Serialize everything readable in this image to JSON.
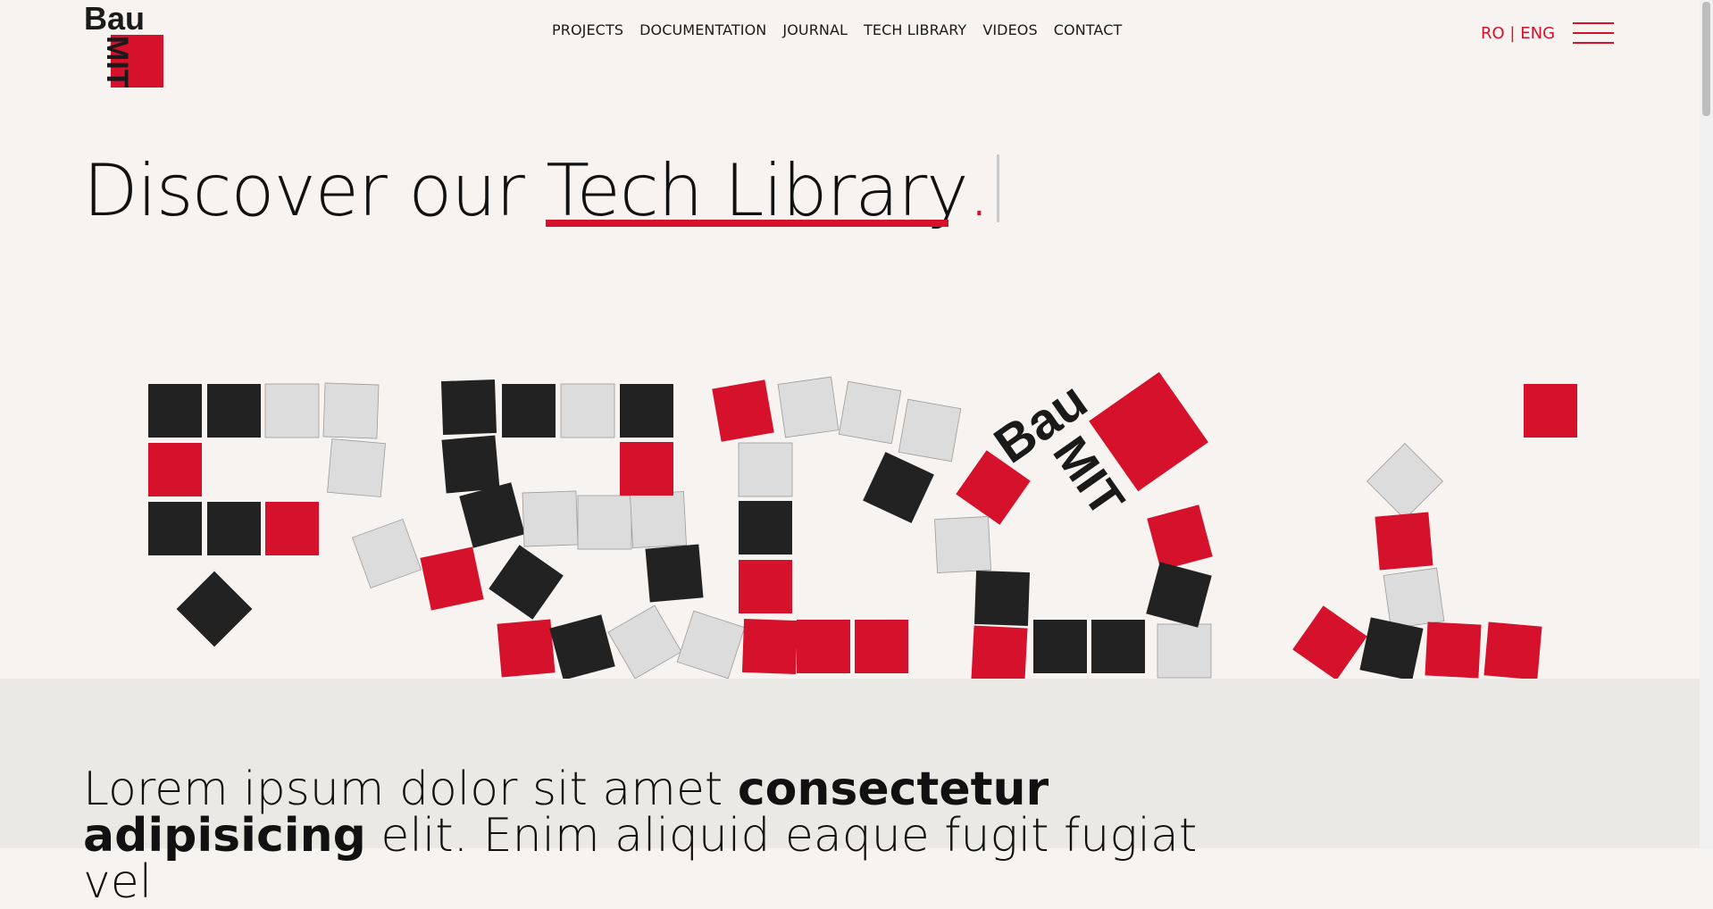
{
  "brand": {
    "logo_top": "Bau",
    "logo_bottom": "MIT",
    "accent": "#d6112b"
  },
  "nav": {
    "projects": "PROJECTS",
    "documentation": "DOCUMENTATION",
    "journal": "JOURNAL",
    "tech_library": "TECH LIBRARY",
    "videos": "VIDEOS",
    "contact": "CONTACT"
  },
  "lang": {
    "ro": "RO",
    "sep": "|",
    "eng": "ENG"
  },
  "menu_icon": "hamburger-icon",
  "hero": {
    "pre": "Discover our ",
    "highlight": "Tech Library",
    "dot": "."
  },
  "intro": {
    "p1": "Lorem ipsum dolor sit amet ",
    "b1": "consectetur",
    "b2": "adipisicing",
    "p2": " elit. Enim aliquid eaque fugit fugiat vel"
  }
}
